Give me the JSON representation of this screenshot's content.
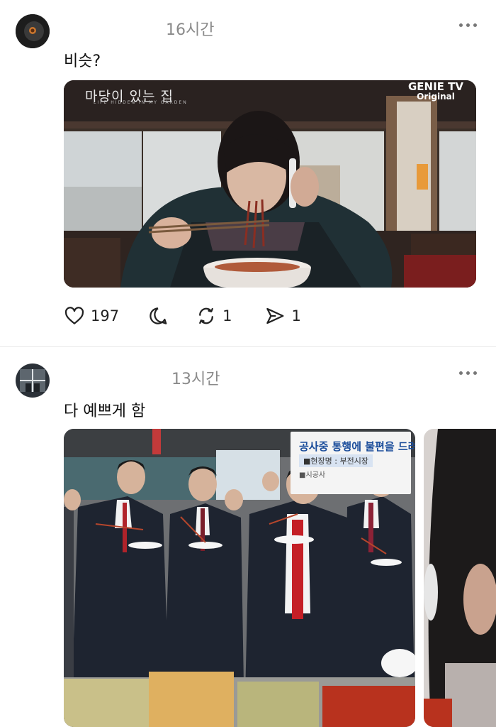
{
  "posts": [
    {
      "time": "16시간",
      "text": "비슷?",
      "media": {
        "show_title": "마당이 있는 집",
        "show_subtitle": "LIFE HIDDEN IN MY GARDEN",
        "brand": "GENIE TV",
        "brand_sub": "Original"
      },
      "actions": {
        "likes": "197",
        "replies": "",
        "reposts": "1",
        "shares": "1"
      }
    },
    {
      "time": "13시간",
      "text": "다 예쁘게 함",
      "media": {
        "sign_line1": "공사중 통행에 불편을 드려",
        "sign_line2": "■현장명 : 부전시장",
        "sign_line3": "■시공사"
      }
    }
  ],
  "colors": {
    "background": "#ffffff",
    "muted": "#8a8a8a",
    "divider": "#e7e7e7",
    "icon": "#222222"
  }
}
